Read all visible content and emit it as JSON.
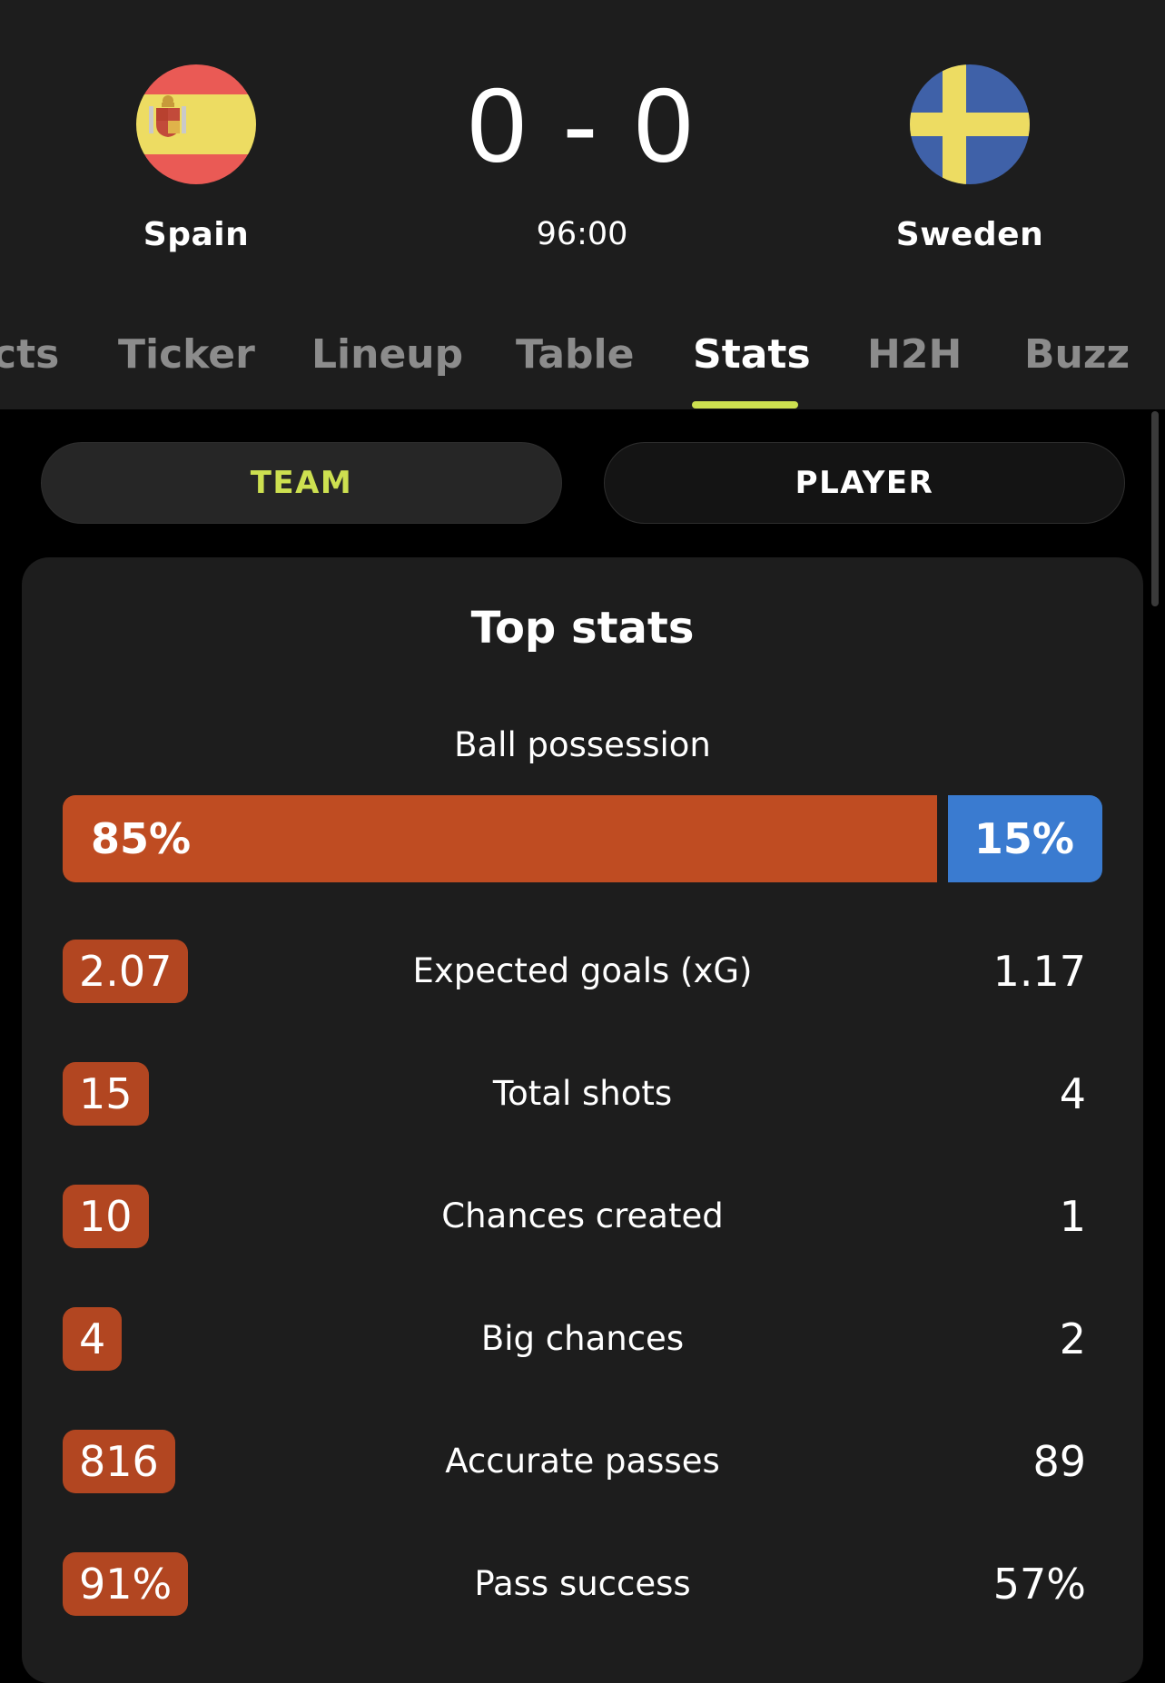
{
  "match": {
    "home_team": "Spain",
    "away_team": "Sweden",
    "score": "0 - 0",
    "time": "96:00",
    "home_flag_icon": "spain-flag-icon",
    "away_flag_icon": "sweden-flag-icon"
  },
  "tabs": [
    {
      "label": "cts",
      "active": false
    },
    {
      "label": "Ticker",
      "active": false
    },
    {
      "label": "Lineup",
      "active": false
    },
    {
      "label": "Table",
      "active": false
    },
    {
      "label": "Stats",
      "active": true
    },
    {
      "label": "H2H",
      "active": false
    },
    {
      "label": "Buzz",
      "active": false
    }
  ],
  "toggle": {
    "team_label": "TEAM",
    "player_label": "PLAYER",
    "selected": "TEAM"
  },
  "top_stats": {
    "title": "Top stats",
    "possession": {
      "label": "Ball possession",
      "home": "85%",
      "away": "15%",
      "home_fraction": 0.85
    },
    "rows": [
      {
        "label": "Expected goals (xG)",
        "home": "2.07",
        "away": "1.17"
      },
      {
        "label": "Total shots",
        "home": "15",
        "away": "4"
      },
      {
        "label": "Chances created",
        "home": "10",
        "away": "1"
      },
      {
        "label": "Big chances",
        "home": "4",
        "away": "2"
      },
      {
        "label": "Accurate passes",
        "home": "816",
        "away": "89"
      },
      {
        "label": "Pass success",
        "home": "91%",
        "away": "57%"
      }
    ]
  },
  "colors": {
    "accent": "#cde050",
    "home": "#bf4c22",
    "away": "#3a7bd0",
    "background": "#000000",
    "card": "#1d1d1d"
  }
}
